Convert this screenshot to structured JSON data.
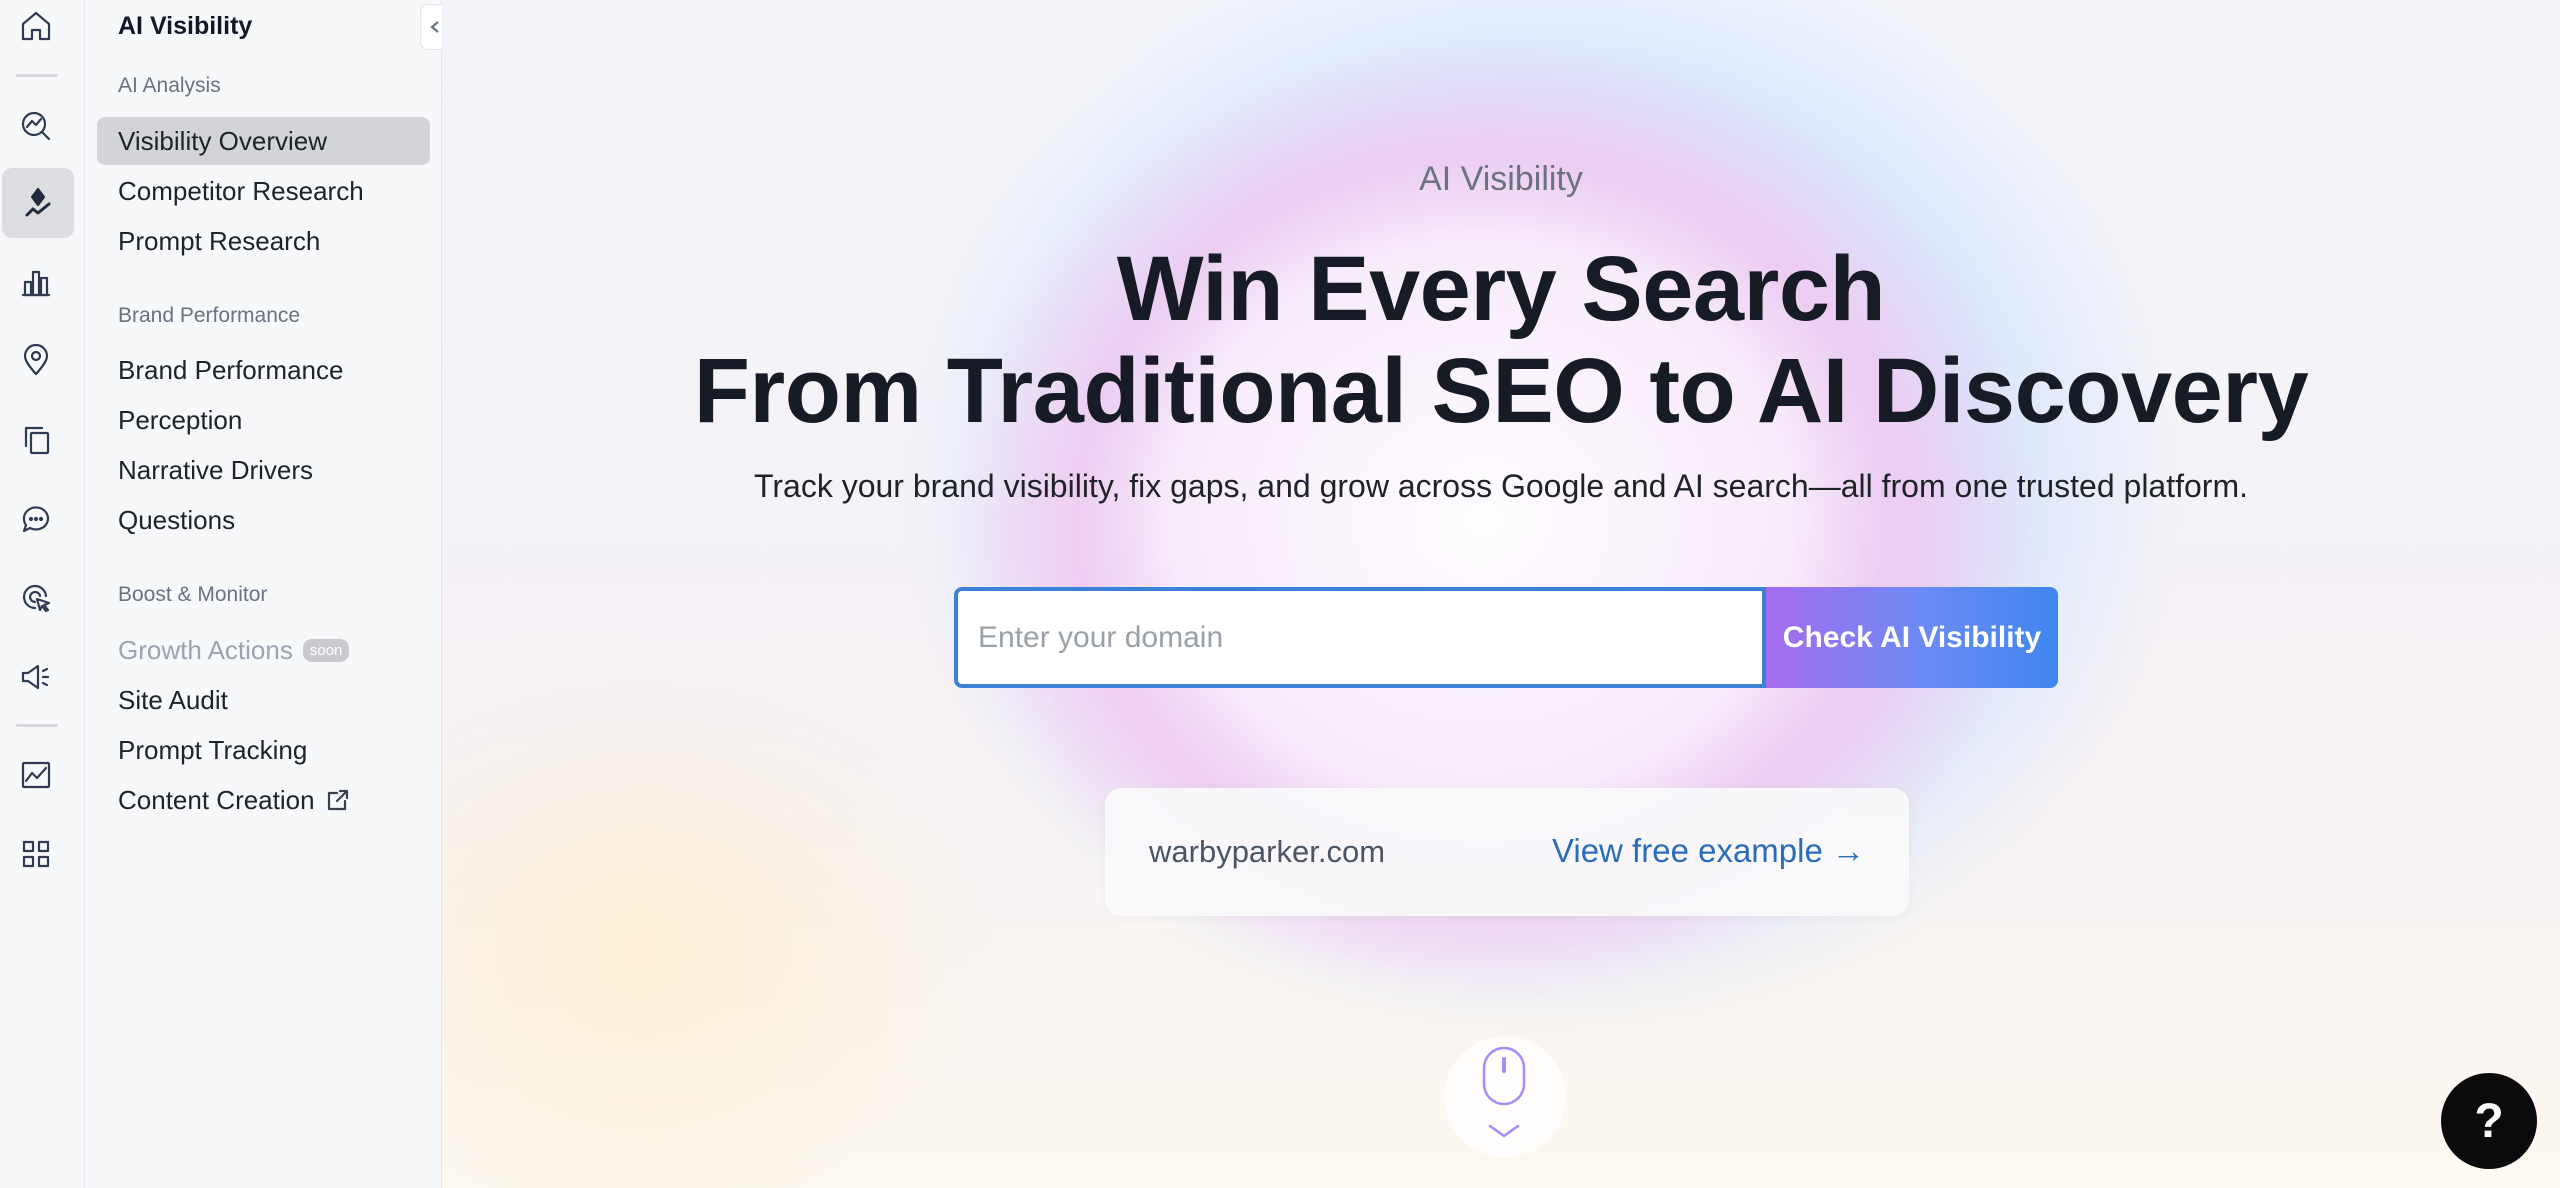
{
  "rail": {
    "icons": [
      "home-icon",
      "analytics-icon",
      "ai-visibility-icon",
      "bar-chart-icon",
      "location-pin-icon",
      "copy-pages-icon",
      "chat-bubble-icon",
      "cursor-target-icon",
      "megaphone-icon",
      "trend-chart-icon",
      "apps-grid-icon"
    ],
    "active": "ai-visibility-icon"
  },
  "sidebar": {
    "title": "AI Visibility",
    "sections": [
      {
        "label": "AI Analysis",
        "items": [
          {
            "label": "Visibility Overview",
            "active": true
          },
          {
            "label": "Competitor Research"
          },
          {
            "label": "Prompt Research"
          }
        ]
      },
      {
        "label": "Brand Performance",
        "items": [
          {
            "label": "Brand Performance"
          },
          {
            "label": "Perception"
          },
          {
            "label": "Narrative Drivers"
          },
          {
            "label": "Questions"
          }
        ]
      },
      {
        "label": "Boost & Monitor",
        "items": [
          {
            "label": "Growth Actions",
            "badge": "soon",
            "disabled": true
          },
          {
            "label": "Site Audit"
          },
          {
            "label": "Prompt Tracking"
          },
          {
            "label": "Content Creation",
            "external": true
          }
        ]
      }
    ]
  },
  "hero": {
    "eyebrow": "AI Visibility",
    "headline_line1": "Win Every Search",
    "headline_line2": "From Traditional SEO to AI Discovery",
    "subtitle": "Track your brand visibility, fix gaps, and grow across Google and AI search—all from one trusted platform.",
    "input_placeholder": "Enter your domain",
    "input_value": "",
    "button_label": "Check AI Visibility"
  },
  "example": {
    "domain": "warbyparker.com",
    "link_label": "View free example →"
  },
  "help": {
    "label": "?"
  },
  "colors": {
    "accent_blue": "#3b82d6",
    "button_gradient_start": "#a56cf0",
    "button_gradient_end": "#3f86ef",
    "link": "#2b6cb9"
  }
}
